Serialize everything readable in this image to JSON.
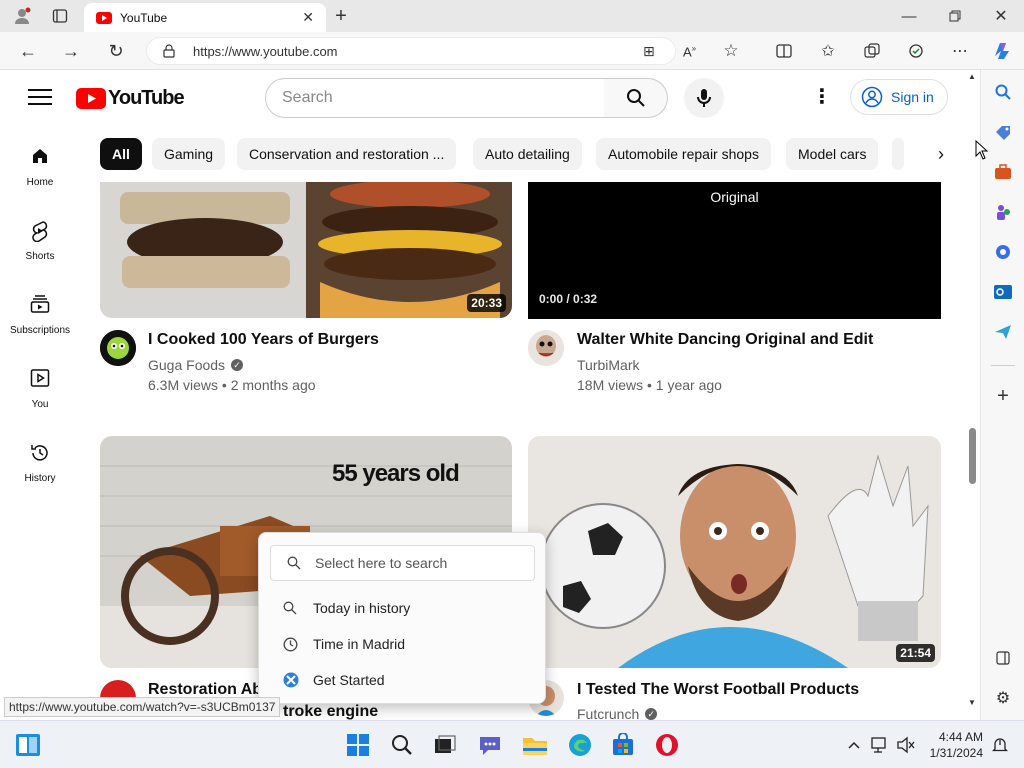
{
  "browser": {
    "tab_title": "YouTube",
    "url": "https://www.youtube.com",
    "status_url": "https://www.youtube.com/watch?v=-s3UCBm0137"
  },
  "youtube": {
    "logo_text": "YouTube",
    "search_placeholder": "Search",
    "sign_in_label": "Sign in",
    "chips": [
      "All",
      "Gaming",
      "Conservation and restoration ...",
      "Auto detailing",
      "Automobile repair shops",
      "Model cars"
    ],
    "nav": [
      {
        "label": "Home",
        "icon": "home-icon"
      },
      {
        "label": "Shorts",
        "icon": "shorts-icon"
      },
      {
        "label": "Subscriptions",
        "icon": "subscriptions-icon"
      },
      {
        "label": "You",
        "icon": "you-icon"
      },
      {
        "label": "History",
        "icon": "history-icon"
      }
    ],
    "videos": [
      {
        "title": "I Cooked 100 Years of Burgers",
        "channel": "Guga Foods",
        "meta": "6.3M views • 2 months ago",
        "duration": "20:33"
      },
      {
        "title": "Walter White Dancing Original and Edit",
        "channel": "TurbiMark",
        "meta": "18M views • 1 year ago",
        "player_label": "Original",
        "player_time": "0:00 / 0:32"
      },
      {
        "title": "Restoration Aba",
        "title_line2": "troke engine",
        "thumb_text": "55 years old"
      },
      {
        "title": "I Tested The Worst Football Products",
        "channel": "Futcrunch",
        "duration": "21:54"
      }
    ]
  },
  "popup": {
    "search_placeholder": "Select here to search",
    "items": [
      "Today in history",
      "Time in Madrid",
      "Get Started"
    ]
  },
  "taskbar": {
    "time": "4:44 AM",
    "date": "1/31/2024"
  },
  "colors": {
    "youtube_red": "#ff0000",
    "sign_in_blue": "#065fd4"
  }
}
